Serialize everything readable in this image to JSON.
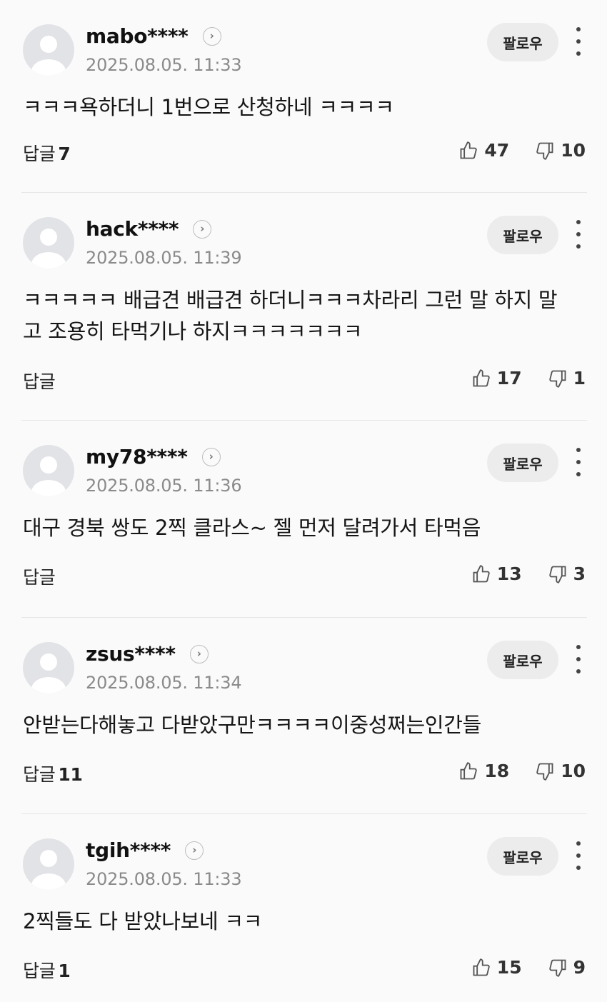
{
  "follow_label": "팔로우",
  "reply_label": "답글",
  "comments": [
    {
      "user": "mabo****",
      "date": "2025.08.05. 11:33",
      "text": "ㅋㅋㅋ욕하더니 1번으로 산청하네 ㅋㅋㅋㅋ",
      "replies": "7",
      "likes": "47",
      "dislikes": "10"
    },
    {
      "user": "hack****",
      "date": "2025.08.05. 11:39",
      "text": "ㅋㅋㅋㅋㅋ 배급견 배급견 하더니ㅋㅋㅋ차라리 그런 말 하지 말고 조용히 타먹기나 하지ㅋㅋㅋㅋㅋㅋㅋ",
      "replies": "",
      "likes": "17",
      "dislikes": "1"
    },
    {
      "user": "my78****",
      "date": "2025.08.05. 11:36",
      "text": "대구 경북 쌍도 2찍 클라스~ 젤 먼저 달려가서 타먹음",
      "replies": "",
      "likes": "13",
      "dislikes": "3"
    },
    {
      "user": "zsus****",
      "date": "2025.08.05. 11:34",
      "text": "안받는다해놓고 다받았구만ㅋㅋㅋㅋ이중성쩌는인간들",
      "replies": "11",
      "likes": "18",
      "dislikes": "10"
    },
    {
      "user": "tgih****",
      "date": "2025.08.05. 11:33",
      "text": "2찍들도 다 받았나보네 ㅋㅋ",
      "replies": "1",
      "likes": "15",
      "dislikes": "9"
    }
  ]
}
